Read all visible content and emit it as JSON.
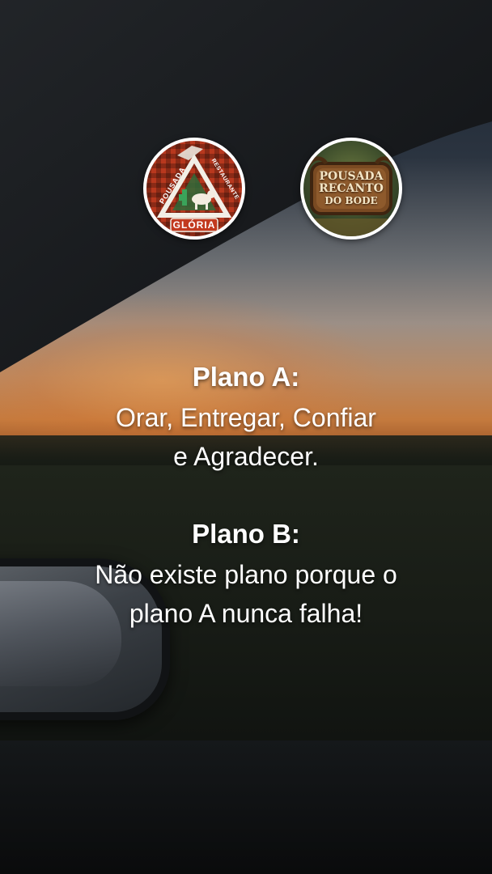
{
  "logos": {
    "left": {
      "text_top": "POUSADA",
      "text_side": "RESTAURANTE",
      "text_bottom": "GLÓRIA"
    },
    "right": {
      "line1": "POUSADA",
      "line2": "RECANTO",
      "line3": "DO BODE"
    }
  },
  "plano_a": {
    "title": "Plano A:",
    "line1": "Orar, Entregar, Confiar",
    "line2": "e Agradecer."
  },
  "plano_b": {
    "title": "Plano B:",
    "line1": "Não existe plano porque o",
    "line2": "plano A nunca falha!"
  },
  "colors": {
    "text": "#ffffff",
    "logo_border": "#ffffff",
    "gloria_red": "#b8381e",
    "bode_wood": "#7a4a22"
  }
}
